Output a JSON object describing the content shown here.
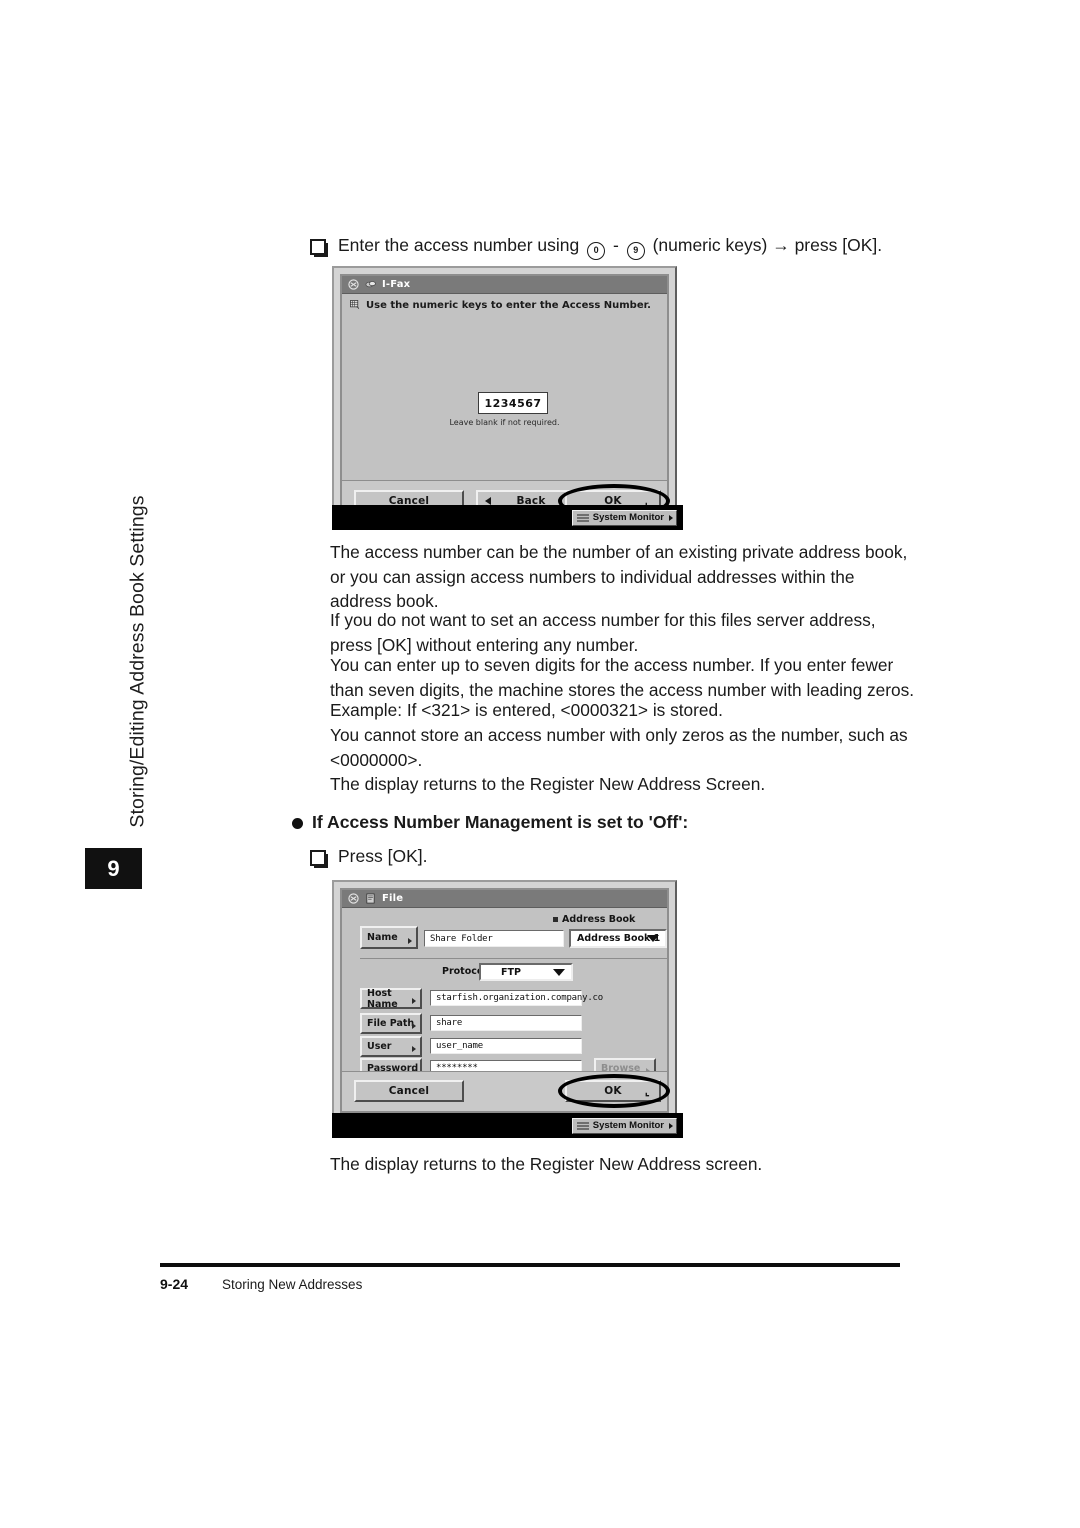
{
  "sidebar": {
    "chapter_title": "Storing/Editing Address Book Settings",
    "chapter_number": "9"
  },
  "steps": {
    "step1": {
      "text_before": "Enter the access number using",
      "key_low": "0",
      "dash": "-",
      "key_high": "9",
      "text_after": "(numeric keys)",
      "arrow": "→",
      "text_end": "press [OK]."
    },
    "step2": {
      "text": "Press [OK]."
    }
  },
  "paragraphs": {
    "p1": "The access number can be the number of an existing private address book, or you can assign access numbers to individual addresses within the address book.",
    "p2": "If you do not want to set an access number for this files server address, press [OK] without entering any number.",
    "p3": "You can enter up to seven digits for the access number. If you enter fewer than seven digits, the machine stores the access number with leading zeros.",
    "p4": "Example: If <321> is entered, <0000321> is stored.",
    "p5": "You cannot store an access number with only zeros as the number, such as <0000000>.",
    "p6": "The display returns to the Register New Address Screen.",
    "p7": "The display returns to the Register New Address screen."
  },
  "heading": {
    "text": "If Access Number Management is set to 'Off':"
  },
  "screen1": {
    "title": "I-Fax",
    "message": "Use the numeric keys to enter the Access Number.",
    "access_number": "1234567",
    "hint": "Leave blank if not required.",
    "buttons": {
      "cancel": "Cancel",
      "back": "Back",
      "ok": "OK"
    },
    "status": {
      "system_monitor": "System Monitor"
    }
  },
  "screen2": {
    "title": "File",
    "address_book_caption": "Address Book",
    "address_book_value": "Address Book 1",
    "protocol_label": "Protocol:",
    "protocol_value": "FTP",
    "rows": [
      {
        "key": "Name",
        "value": "Share Folder"
      },
      {
        "key": "Host Name",
        "value": "starfish.organization.company.co"
      },
      {
        "key": "File Path",
        "value": "share"
      },
      {
        "key": "User",
        "value": "user_name"
      },
      {
        "key": "Password",
        "value": "********"
      }
    ],
    "browse": "Browse",
    "buttons": {
      "cancel": "Cancel",
      "ok": "OK"
    },
    "status": {
      "system_monitor": "System Monitor"
    }
  },
  "footer": {
    "page_number": "9-24",
    "section_title": "Storing New Addresses"
  },
  "colors": {
    "ink": "#1a1a1a",
    "lcd_bg": "#c2c2c2",
    "titlebar": "#7a7a7a",
    "status_bar": "#000000"
  }
}
